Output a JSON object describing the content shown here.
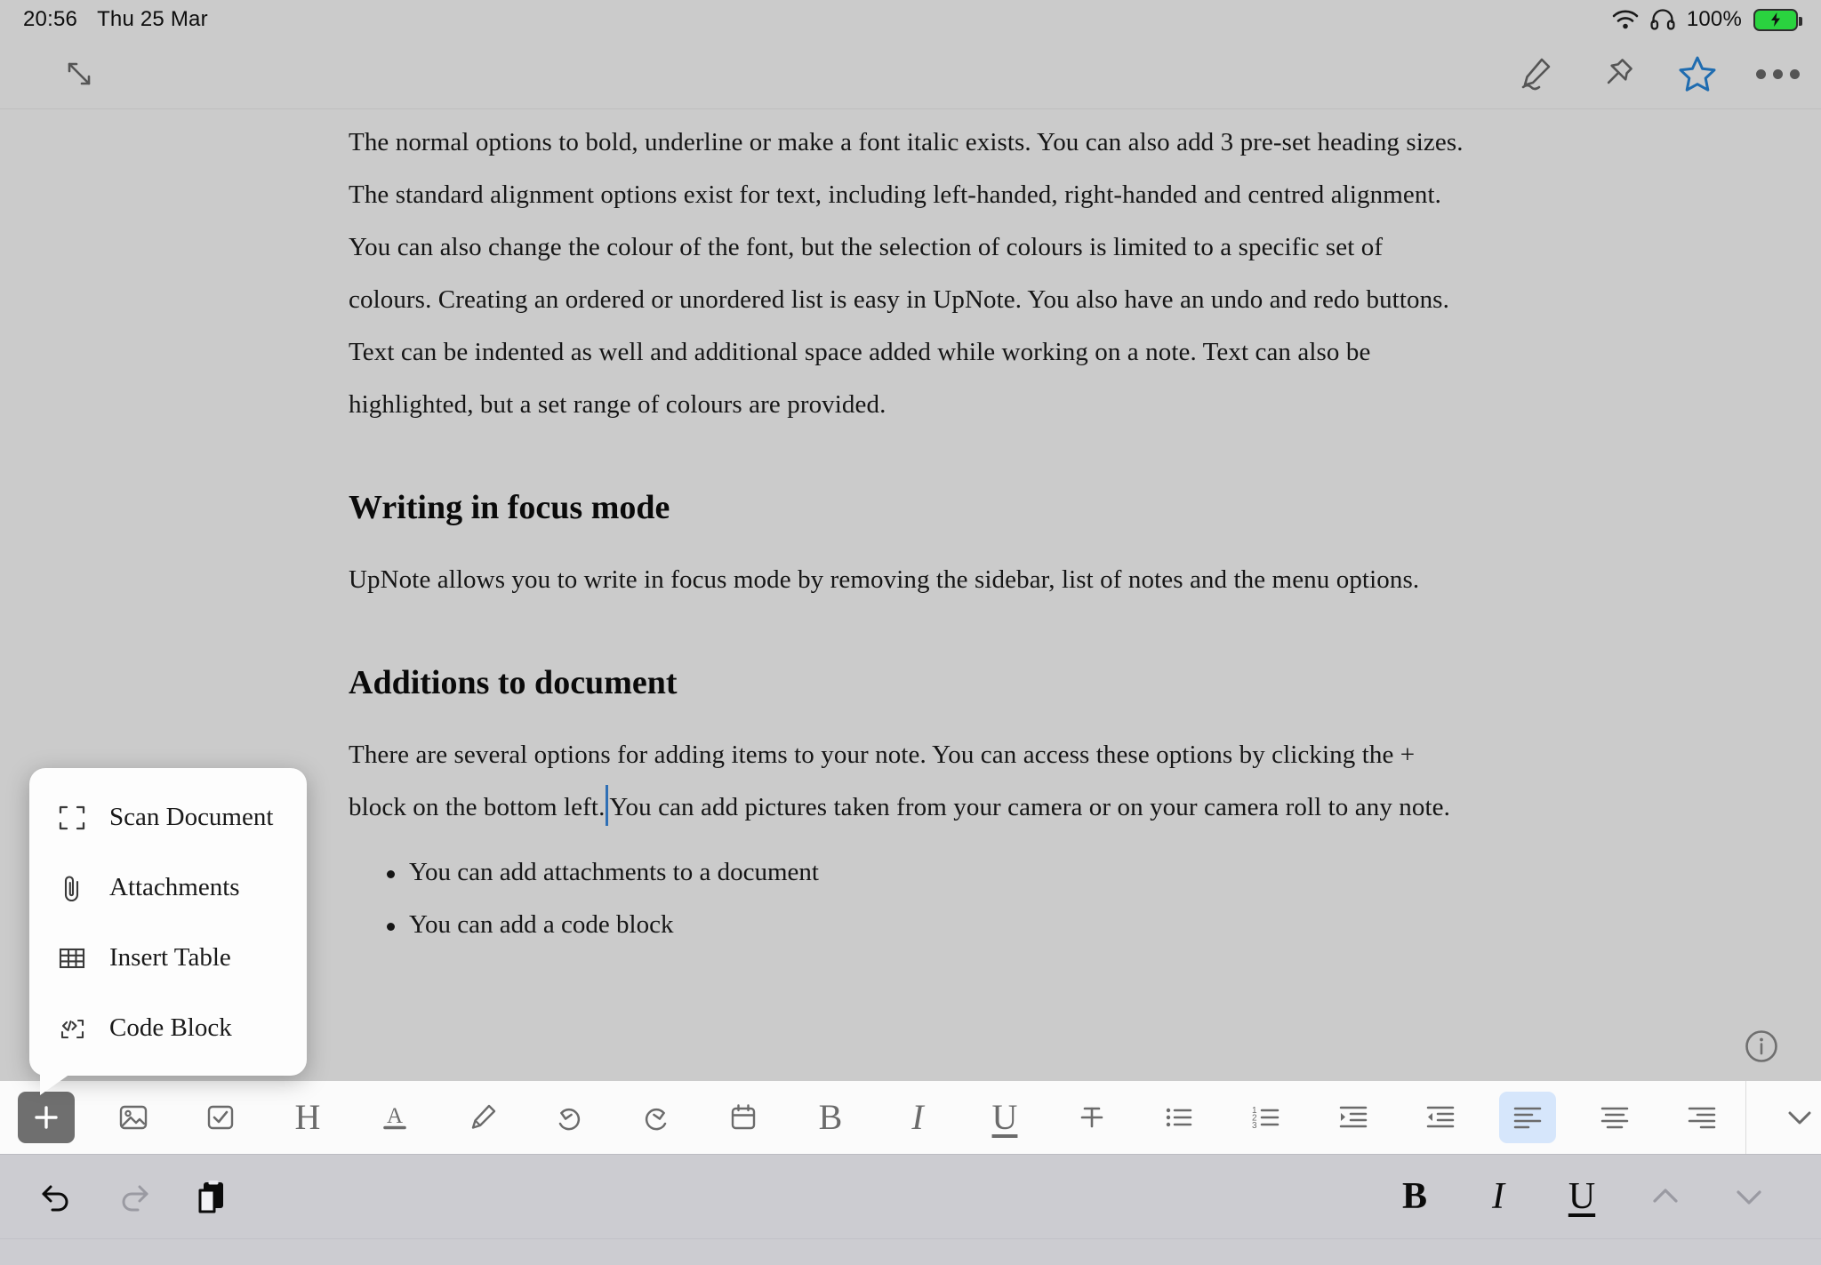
{
  "statusbar": {
    "time": "20:56",
    "date": "Thu 25 Mar",
    "battery_percent": "100%",
    "icons": [
      "wifi-icon",
      "headphones-icon",
      "battery-charging-icon"
    ]
  },
  "topbar": {
    "expand_label": "expand-collapse-icon",
    "actions": [
      {
        "name": "pencil-draw-icon",
        "label": "Draw"
      },
      {
        "name": "pin-icon",
        "label": "Pin"
      },
      {
        "name": "star-icon",
        "label": "Favourite"
      },
      {
        "name": "more-options-icon",
        "label": "More"
      }
    ],
    "star_color": "#1f6cb0"
  },
  "document": {
    "paragraphs": [
      "The normal options to bold, underline or make a font italic exists. You can also add 3 pre-set heading sizes. The standard alignment options exist for text, including left-handed, right-handed and centred alignment.",
      "You can also change the colour of the font, but the selection of colours is limited to a specific set of colours. Creating an ordered or unordered list is easy in UpNote. You also have an undo and redo buttons. Text can be indented as well and additional space added while working on a note. Text can also be highlighted, but a set range of colours are provided."
    ],
    "heading_focus": "Writing in focus mode",
    "paragraph_focus": "UpNote allows you to write in focus mode by removing the sidebar, list of notes and the menu options.",
    "heading_additions": "Additions to document",
    "paragraph_additions_before": "There are several options for adding items to your note. You can access these options by clicking the + block on the bottom left.",
    "paragraph_additions_after": "You can add pictures taken from your camera or on your camera roll to any note.",
    "bullets": [
      "You can add attachments to a document",
      "You can add a code block"
    ],
    "caret_color": "#2f6fb5",
    "info_icon": "info-circle-icon"
  },
  "popup": {
    "items": [
      {
        "icon": "scan-document-icon",
        "label": "Scan Document"
      },
      {
        "icon": "paperclip-icon",
        "label": "Attachments"
      },
      {
        "icon": "table-icon",
        "label": "Insert Table"
      },
      {
        "icon": "code-block-icon",
        "label": "Code Block"
      }
    ]
  },
  "format_toolbar": {
    "buttons": [
      {
        "name": "add-block-button",
        "icon": "plus-icon",
        "label": "Add",
        "state": "active-dark"
      },
      {
        "name": "insert-image-button",
        "icon": "image-icon",
        "label": "Image",
        "state": ""
      },
      {
        "name": "checklist-button",
        "icon": "checkbox-icon",
        "label": "Checklist",
        "state": ""
      },
      {
        "name": "heading-button",
        "icon": "heading-h-icon",
        "label": "H",
        "state": ""
      },
      {
        "name": "font-color-button",
        "icon": "font-color-a-icon",
        "label": "Font colour",
        "state": ""
      },
      {
        "name": "highlight-button",
        "icon": "highlighter-icon",
        "label": "Highlight",
        "state": ""
      },
      {
        "name": "undo-button",
        "icon": "undo-icon",
        "label": "Undo",
        "state": ""
      },
      {
        "name": "redo-button",
        "icon": "redo-icon",
        "label": "Redo",
        "state": ""
      },
      {
        "name": "date-button",
        "icon": "calendar-icon",
        "label": "Date",
        "state": ""
      },
      {
        "name": "bold-button",
        "icon": "bold-b-icon",
        "label": "B",
        "state": ""
      },
      {
        "name": "italic-button",
        "icon": "italic-i-icon",
        "label": "I",
        "state": ""
      },
      {
        "name": "underline-button",
        "icon": "underline-u-icon",
        "label": "U",
        "state": ""
      },
      {
        "name": "strikethrough-button",
        "icon": "strikethrough-icon",
        "label": "Strikethrough",
        "state": ""
      },
      {
        "name": "bullet-list-button",
        "icon": "bullet-list-icon",
        "label": "Bullet list",
        "state": ""
      },
      {
        "name": "numbered-list-button",
        "icon": "numbered-list-icon",
        "label": "Numbered list",
        "state": ""
      },
      {
        "name": "indent-button",
        "icon": "indent-increase-icon",
        "label": "Indent",
        "state": ""
      },
      {
        "name": "outdent-button",
        "icon": "indent-decrease-icon",
        "label": "Outdent",
        "state": ""
      },
      {
        "name": "align-left-button",
        "icon": "align-left-icon",
        "label": "Align left",
        "state": "active-blue"
      },
      {
        "name": "align-center-button",
        "icon": "align-center-icon",
        "label": "Align centre",
        "state": ""
      },
      {
        "name": "align-right-button",
        "icon": "align-right-icon",
        "label": "Align right",
        "state": ""
      }
    ],
    "collapse": {
      "name": "collapse-toolbar-button",
      "icon": "chevron-down-icon"
    },
    "active_highlight_color": "#d6e6fb",
    "active_dark_color": "#6f6f6f"
  },
  "keyboard_bar": {
    "left": [
      {
        "name": "kb-undo-button",
        "icon": "undo-arrow-icon",
        "enabled": true
      },
      {
        "name": "kb-redo-button",
        "icon": "redo-arrow-icon",
        "enabled": false
      },
      {
        "name": "kb-paste-button",
        "icon": "paste-clipboard-icon",
        "enabled": true
      }
    ],
    "right": [
      {
        "name": "kb-bold-button",
        "label": "B",
        "enabled": true
      },
      {
        "name": "kb-italic-button",
        "label": "I",
        "enabled": true
      },
      {
        "name": "kb-underline-button",
        "label": "U",
        "enabled": true
      },
      {
        "name": "kb-prev-button",
        "icon": "chevron-up-icon",
        "enabled": false
      },
      {
        "name": "kb-next-button",
        "icon": "chevron-down-icon",
        "enabled": false
      }
    ]
  }
}
